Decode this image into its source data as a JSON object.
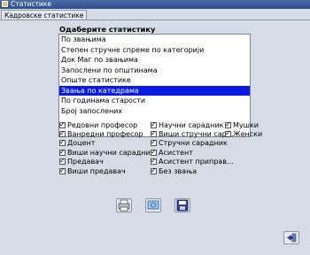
{
  "window": {
    "title": "Статистике"
  },
  "tab": {
    "label": "Кадровске статистике"
  },
  "list": {
    "title": "Одаберите статистику",
    "items": [
      "По звањима",
      "Степен стручне спреме по категорији",
      "Док Маг по звањима",
      "Запослени по општинама",
      "Опште статистике",
      "Звања по катедрама",
      "По годинама старости",
      "Број запослених"
    ],
    "selected_index": 5
  },
  "checkboxes": {
    "col1": [
      "Редовни професор",
      "Ванредни професор",
      "Доцент",
      "Виши научни сарадник",
      "Предавач",
      "Виши предавач"
    ],
    "col2": [
      "Научни сарадник",
      "Виши стручни сар...",
      "Стручни сарадник",
      "Асистент",
      "Асистент приправ...",
      "Без звања"
    ],
    "col3": [
      "Мушки",
      "Женски"
    ]
  },
  "colors": {
    "selection": "#0a1be6",
    "titlebar": "#2e4f86",
    "background": "#d6dce6"
  },
  "icons": {
    "print": "printer-icon",
    "preview": "preview-icon",
    "save": "save-icon",
    "exit": "exit-icon"
  }
}
